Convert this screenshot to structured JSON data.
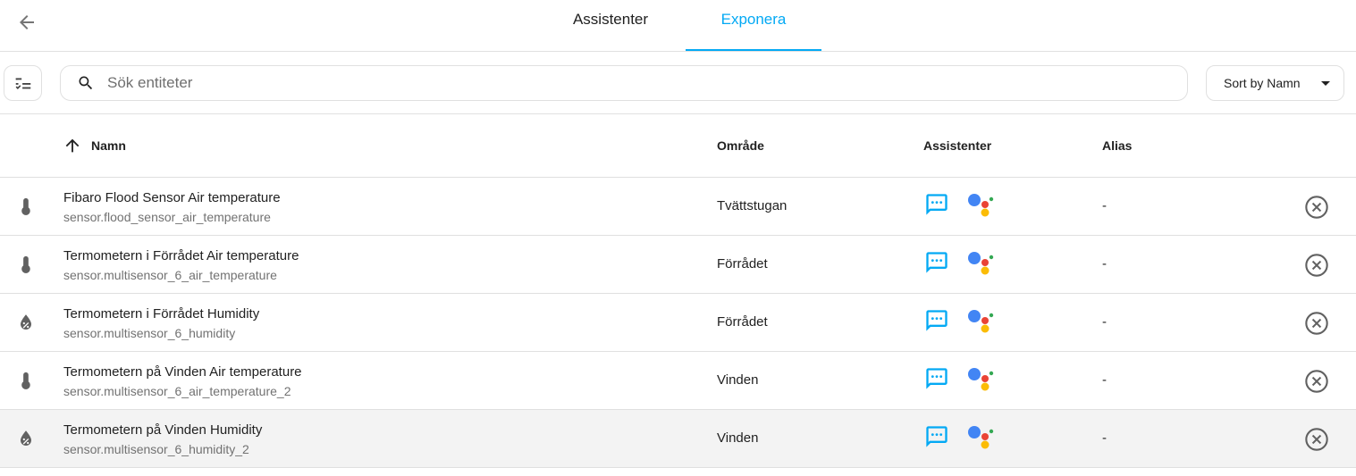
{
  "header": {
    "back_icon": "arrow-left-icon",
    "tabs": [
      {
        "label": "Assistenter",
        "active": false
      },
      {
        "label": "Exponera",
        "active": true
      }
    ],
    "accent_color": "#03a9f4"
  },
  "toolbar": {
    "filter_icon": "filter-list-icon",
    "search": {
      "icon": "search-icon",
      "placeholder": "Sök entiteter",
      "value": ""
    },
    "sort_label": "Sort by Namn"
  },
  "table": {
    "columns": {
      "name": "Namn",
      "area": "Område",
      "assistants": "Assistenter",
      "alias": "Alias"
    },
    "sort_icon": "arrow-up-icon",
    "rows": [
      {
        "icon": "thermometer-icon",
        "name": "Fibaro Flood Sensor Air temperature",
        "entity_id": "sensor.flood_sensor_air_temperature",
        "area": "Tvättstugan",
        "alias": "-"
      },
      {
        "icon": "thermometer-icon",
        "name": "Termometern i Förrådet Air temperature",
        "entity_id": "sensor.multisensor_6_air_temperature",
        "area": "Förrådet",
        "alias": "-"
      },
      {
        "icon": "water-percent-icon",
        "name": "Termometern i Förrådet Humidity",
        "entity_id": "sensor.multisensor_6_humidity",
        "area": "Förrådet",
        "alias": "-"
      },
      {
        "icon": "thermometer-icon",
        "name": "Termometern på Vinden Air temperature",
        "entity_id": "sensor.multisensor_6_air_temperature_2",
        "area": "Vinden",
        "alias": "-"
      },
      {
        "icon": "water-percent-icon",
        "name": "Termometern på Vinden Humidity",
        "entity_id": "sensor.multisensor_6_humidity_2",
        "area": "Vinden",
        "alias": "-"
      }
    ]
  }
}
